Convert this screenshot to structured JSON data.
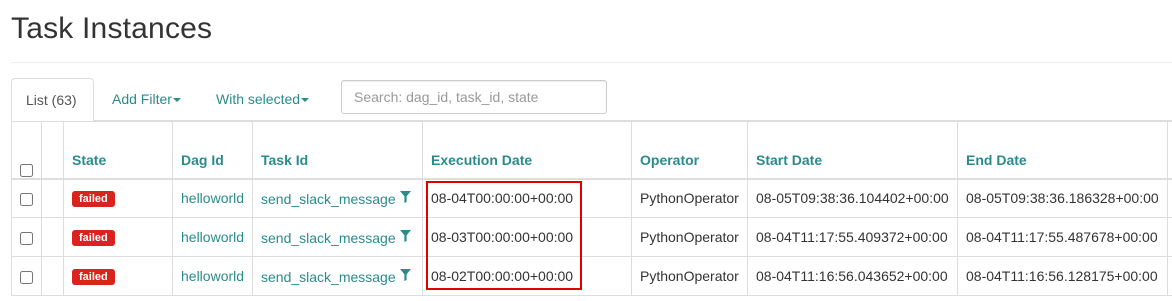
{
  "page": {
    "title": "Task Instances"
  },
  "tabs": {
    "list_label": "List (63)",
    "add_filter_label": "Add Filter",
    "with_selected_label": "With selected"
  },
  "search": {
    "placeholder": "Search: dag_id, task_id, state",
    "value": ""
  },
  "table": {
    "columns": [
      "State",
      "Dag Id",
      "Task Id",
      "Execution Date",
      "Operator",
      "Start Date",
      "End Date"
    ],
    "rows": [
      {
        "state": "failed",
        "dag_id": "helloworld",
        "task_id": "send_slack_message",
        "execution_date": "08-04T00:00:00+00:00",
        "operator": "PythonOperator",
        "start_date": "08-05T09:38:36.104402+00:00",
        "end_date": "08-05T09:38:36.186328+00:00"
      },
      {
        "state": "failed",
        "dag_id": "helloworld",
        "task_id": "send_slack_message",
        "execution_date": "08-03T00:00:00+00:00",
        "operator": "PythonOperator",
        "start_date": "08-04T11:17:55.409372+00:00",
        "end_date": "08-04T11:17:55.487678+00:00"
      },
      {
        "state": "failed",
        "dag_id": "helloworld",
        "task_id": "send_slack_message",
        "execution_date": "08-02T00:00:00+00:00",
        "operator": "PythonOperator",
        "start_date": "08-04T11:16:56.043652+00:00",
        "end_date": "08-04T11:16:56.128175+00:00"
      }
    ]
  },
  "icons": {
    "row_filter": "filter-icon"
  },
  "colors": {
    "link": "#2a8b8b",
    "failed_badge": "#d9231d",
    "highlight": "#e00000"
  }
}
